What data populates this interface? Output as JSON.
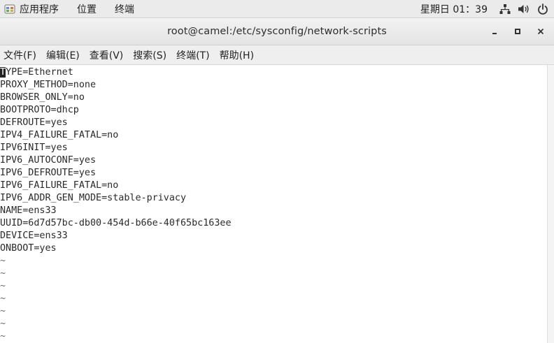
{
  "top_panel": {
    "applications_label": "应用程序",
    "places_label": "位置",
    "terminal_label": "终端",
    "clock": "星期日 01：39",
    "icons": [
      "network-icon",
      "volume-icon",
      "power-icon"
    ]
  },
  "window": {
    "title": "root@camel:/etc/sysconfig/network-scripts",
    "buttons": [
      "minimize-icon",
      "maximize-icon",
      "close-icon"
    ]
  },
  "menubar": {
    "items": [
      "文件(F)",
      "编辑(E)",
      "查看(V)",
      "搜索(S)",
      "终端(T)",
      "帮助(H)"
    ]
  },
  "terminal": {
    "cursor_char": "T",
    "first_line_rest": "YPE=Ethernet",
    "lines": [
      "PROXY_METHOD=none",
      "BROWSER_ONLY=no",
      "BOOTPROTO=dhcp",
      "DEFROUTE=yes",
      "IPV4_FAILURE_FATAL=no",
      "IPV6INIT=yes",
      "IPV6_AUTOCONF=yes",
      "IPV6_DEFROUTE=yes",
      "IPV6_FAILURE_FATAL=no",
      "IPV6_ADDR_GEN_MODE=stable-privacy",
      "NAME=ens33",
      "UUID=6d7d57bc-db00-454d-b66e-40f65bc163ee",
      "DEVICE=ens33",
      "ONBOOT=yes"
    ],
    "tildes": [
      "~",
      "~",
      "~",
      "~",
      "~",
      "~",
      "~"
    ]
  },
  "colors": {
    "panel_bg": "#ebebeb",
    "titlebar_bg": "#e9e9e9",
    "menubar_bg": "#efefef",
    "terminal_bg": "#ffffff",
    "terminal_fg": "#2a2a2a"
  }
}
